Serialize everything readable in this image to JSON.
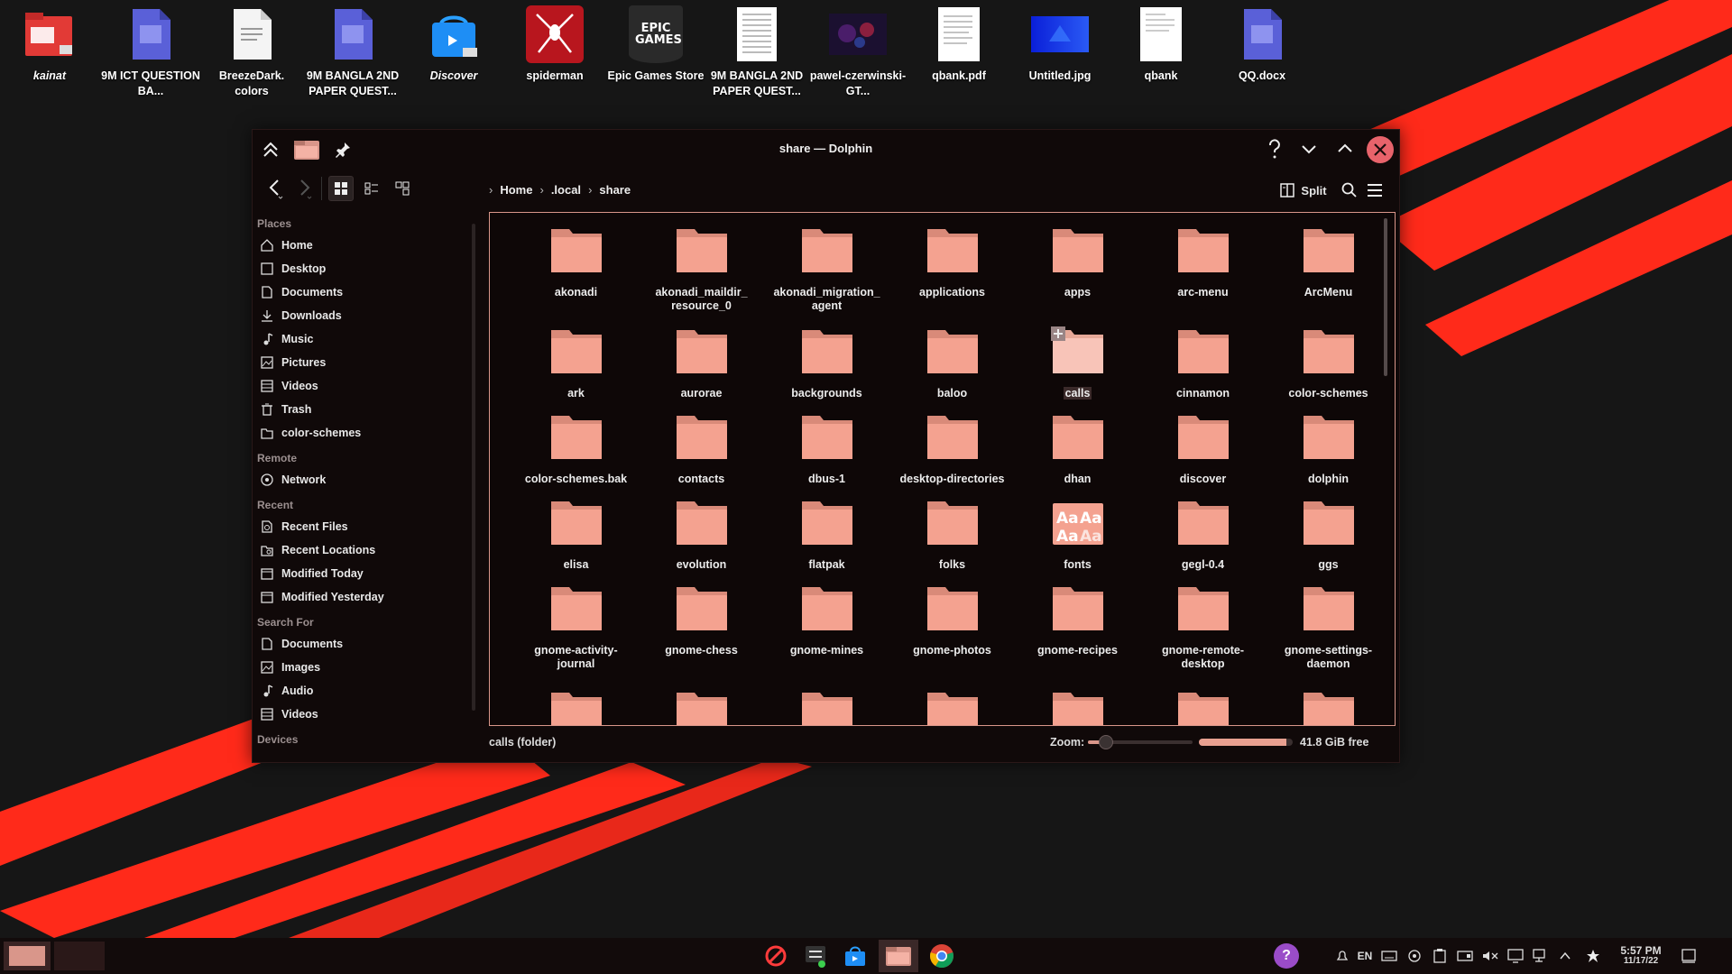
{
  "desktop_icons": [
    {
      "label": "kainat",
      "icon": "folder-red-icon",
      "italic": true
    },
    {
      "label": "9M ICT QUESTION BA...",
      "icon": "docx-icon"
    },
    {
      "label": "BreezeDark. colors",
      "icon": "text-file-icon"
    },
    {
      "label": "9M BANGLA 2ND PAPER QUEST...",
      "icon": "docx-icon"
    },
    {
      "label": "Discover",
      "icon": "discover-store-icon",
      "italic": true
    },
    {
      "label": "spiderman",
      "icon": "spiderman-icon"
    },
    {
      "label": "Epic Games Store",
      "icon": "epic-games-icon"
    },
    {
      "label": "9M BANGLA 2ND PAPER QUEST...",
      "icon": "document-preview-icon"
    },
    {
      "label": "pawel-czerwinski-GT...",
      "icon": "image-thumbnail-icon"
    },
    {
      "label": "qbank.pdf",
      "icon": "pdf-icon"
    },
    {
      "label": "Untitled.jpg",
      "icon": "image-blue-icon"
    },
    {
      "label": "qbank",
      "icon": "text-document-icon"
    },
    {
      "label": "QQ.docx",
      "icon": "docx-icon"
    }
  ],
  "epic_logo": "EPIC GAMES",
  "window": {
    "title": "share — Dolphin",
    "split_label": "Split",
    "breadcrumbs": [
      "Home",
      ".local",
      "share"
    ]
  },
  "sidebar": {
    "places_header": "Places",
    "places": [
      "Home",
      "Desktop",
      "Documents",
      "Downloads",
      "Music",
      "Pictures",
      "Videos",
      "Trash",
      "color-schemes"
    ],
    "remote_header": "Remote",
    "remote": [
      "Network"
    ],
    "recent_header": "Recent",
    "recent": [
      "Recent Files",
      "Recent Locations",
      "Modified Today",
      "Modified Yesterday"
    ],
    "search_header": "Search For",
    "search": [
      "Documents",
      "Images",
      "Audio",
      "Videos"
    ],
    "devices_header": "Devices"
  },
  "folders": [
    "akonadi",
    "akonadi_maildir_\nresource_0",
    "akonadi_migration_\nagent",
    "applications",
    "apps",
    "arc-menu",
    "ArcMenu",
    "ark",
    "aurorae",
    "backgrounds",
    "baloo",
    "calls",
    "cinnamon",
    "color-schemes",
    "color-schemes.bak",
    "contacts",
    "dbus-1",
    "desktop-directories",
    "dhan",
    "discover",
    "dolphin",
    "elisa",
    "evolution",
    "flatpak",
    "folks",
    "fonts",
    "gegl-0.4",
    "ggs",
    "gnome-activity-\njournal",
    "gnome-chess",
    "gnome-mines",
    "gnome-photos",
    "gnome-recipes",
    "gnome-remote-\ndesktop",
    "gnome-settings-\ndaemon",
    "",
    "",
    "",
    "",
    "",
    "",
    ""
  ],
  "selected_folder": "calls",
  "fonts_icon_text": "Aa",
  "status": {
    "selection": "calls (folder)",
    "zoom_label": "Zoom:",
    "zoom_level": 0.17,
    "free_space": "41.8 GiB free",
    "free_fraction": 0.93
  },
  "taskbar": {
    "lang": "EN",
    "time": "5:57 PM",
    "date": "11/17/22"
  },
  "colors": {
    "folder": "#f4a290",
    "folder_tab": "#d98a79",
    "accent": "#ff3320",
    "window_bg": "#100909"
  }
}
